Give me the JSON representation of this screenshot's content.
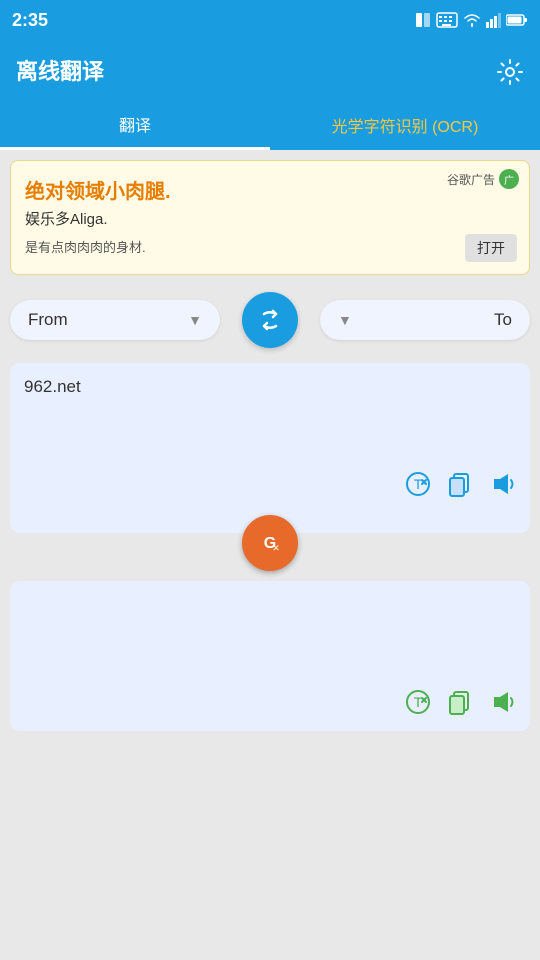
{
  "statusBar": {
    "time": "2:35",
    "icons": [
      "sim-icon",
      "wifi-icon",
      "battery-icon"
    ]
  },
  "header": {
    "title": "离线翻译",
    "gearIcon": "⚙"
  },
  "tabs": [
    {
      "label": "翻译",
      "active": true
    },
    {
      "label": "光学字符识别 (OCR)",
      "active": false
    }
  ],
  "ad": {
    "label": "谷歌广告",
    "iconLabel": "广",
    "mainText": "绝对领域小肉腿.",
    "subText": "娱乐多Aliga.",
    "desc": "是有点肉肉肉的身材.",
    "openBtn": "打开"
  },
  "langSelector": {
    "fromLabel": "From",
    "toLabel": "To",
    "swapIcon": "↺"
  },
  "inputArea": {
    "text": "962.net",
    "clearLabel": "clear-text",
    "copyLabel": "copy",
    "speakLabel": "speak"
  },
  "translateBtn": {
    "icon": "G"
  },
  "outputArea": {
    "text": "",
    "clearLabel": "clear-output",
    "copyLabel": "copy-output",
    "speakLabel": "speak-output"
  }
}
